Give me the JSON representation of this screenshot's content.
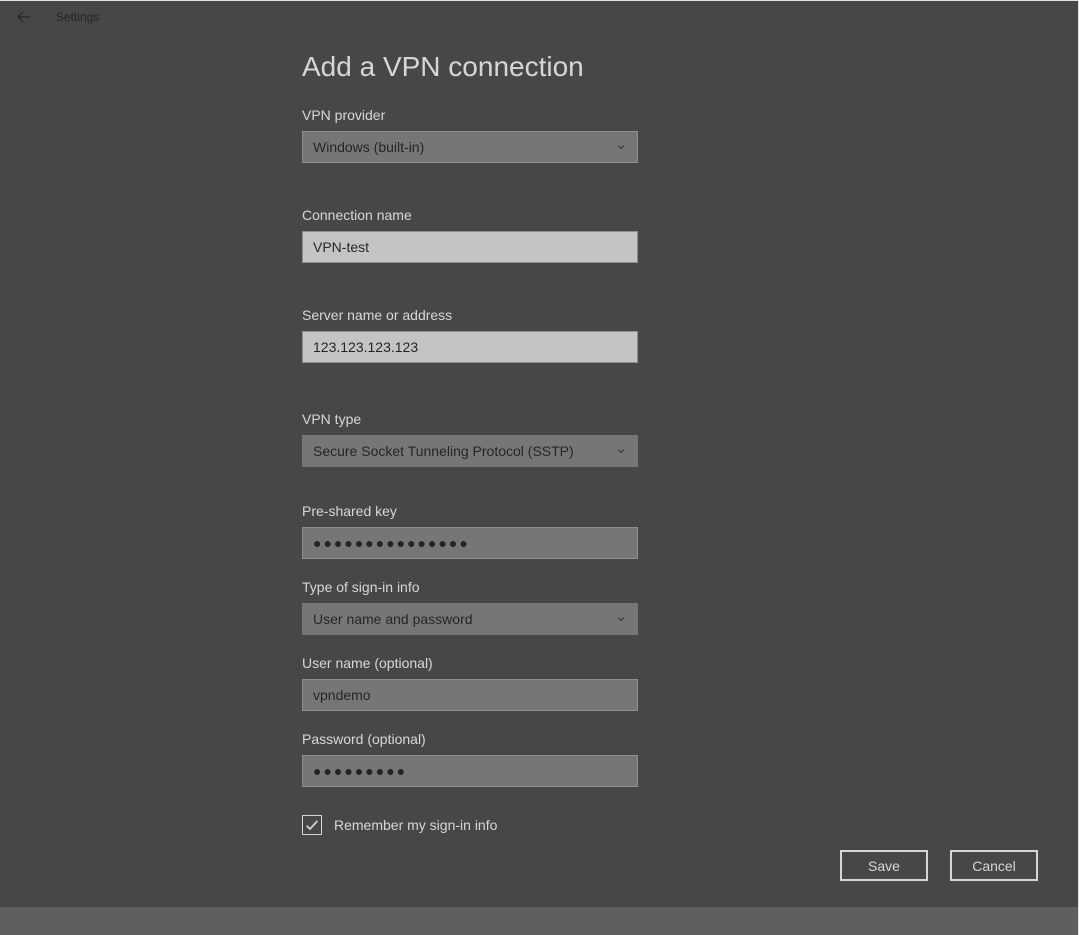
{
  "window": {
    "title": "Settings"
  },
  "page": {
    "title": "Add a VPN connection"
  },
  "fields": {
    "vpn_provider": {
      "label": "VPN provider",
      "value": "Windows (built-in)"
    },
    "connection_name": {
      "label": "Connection name",
      "value": "VPN-test"
    },
    "server_address": {
      "label": "Server name or address",
      "value": "123.123.123.123"
    },
    "vpn_type": {
      "label": "VPN type",
      "value": "Secure Socket Tunneling Protocol (SSTP)"
    },
    "preshared_key": {
      "label": "Pre-shared key",
      "mask": "●●●●●●●●●●●●●●●"
    },
    "signin_type": {
      "label": "Type of sign-in info",
      "value": "User name and password"
    },
    "username": {
      "label": "User name (optional)",
      "value": "vpndemo"
    },
    "password": {
      "label": "Password (optional)",
      "mask": "●●●●●●●●●"
    },
    "remember": {
      "label": "Remember my sign-in info",
      "checked": true
    }
  },
  "buttons": {
    "save": "Save",
    "cancel": "Cancel"
  }
}
